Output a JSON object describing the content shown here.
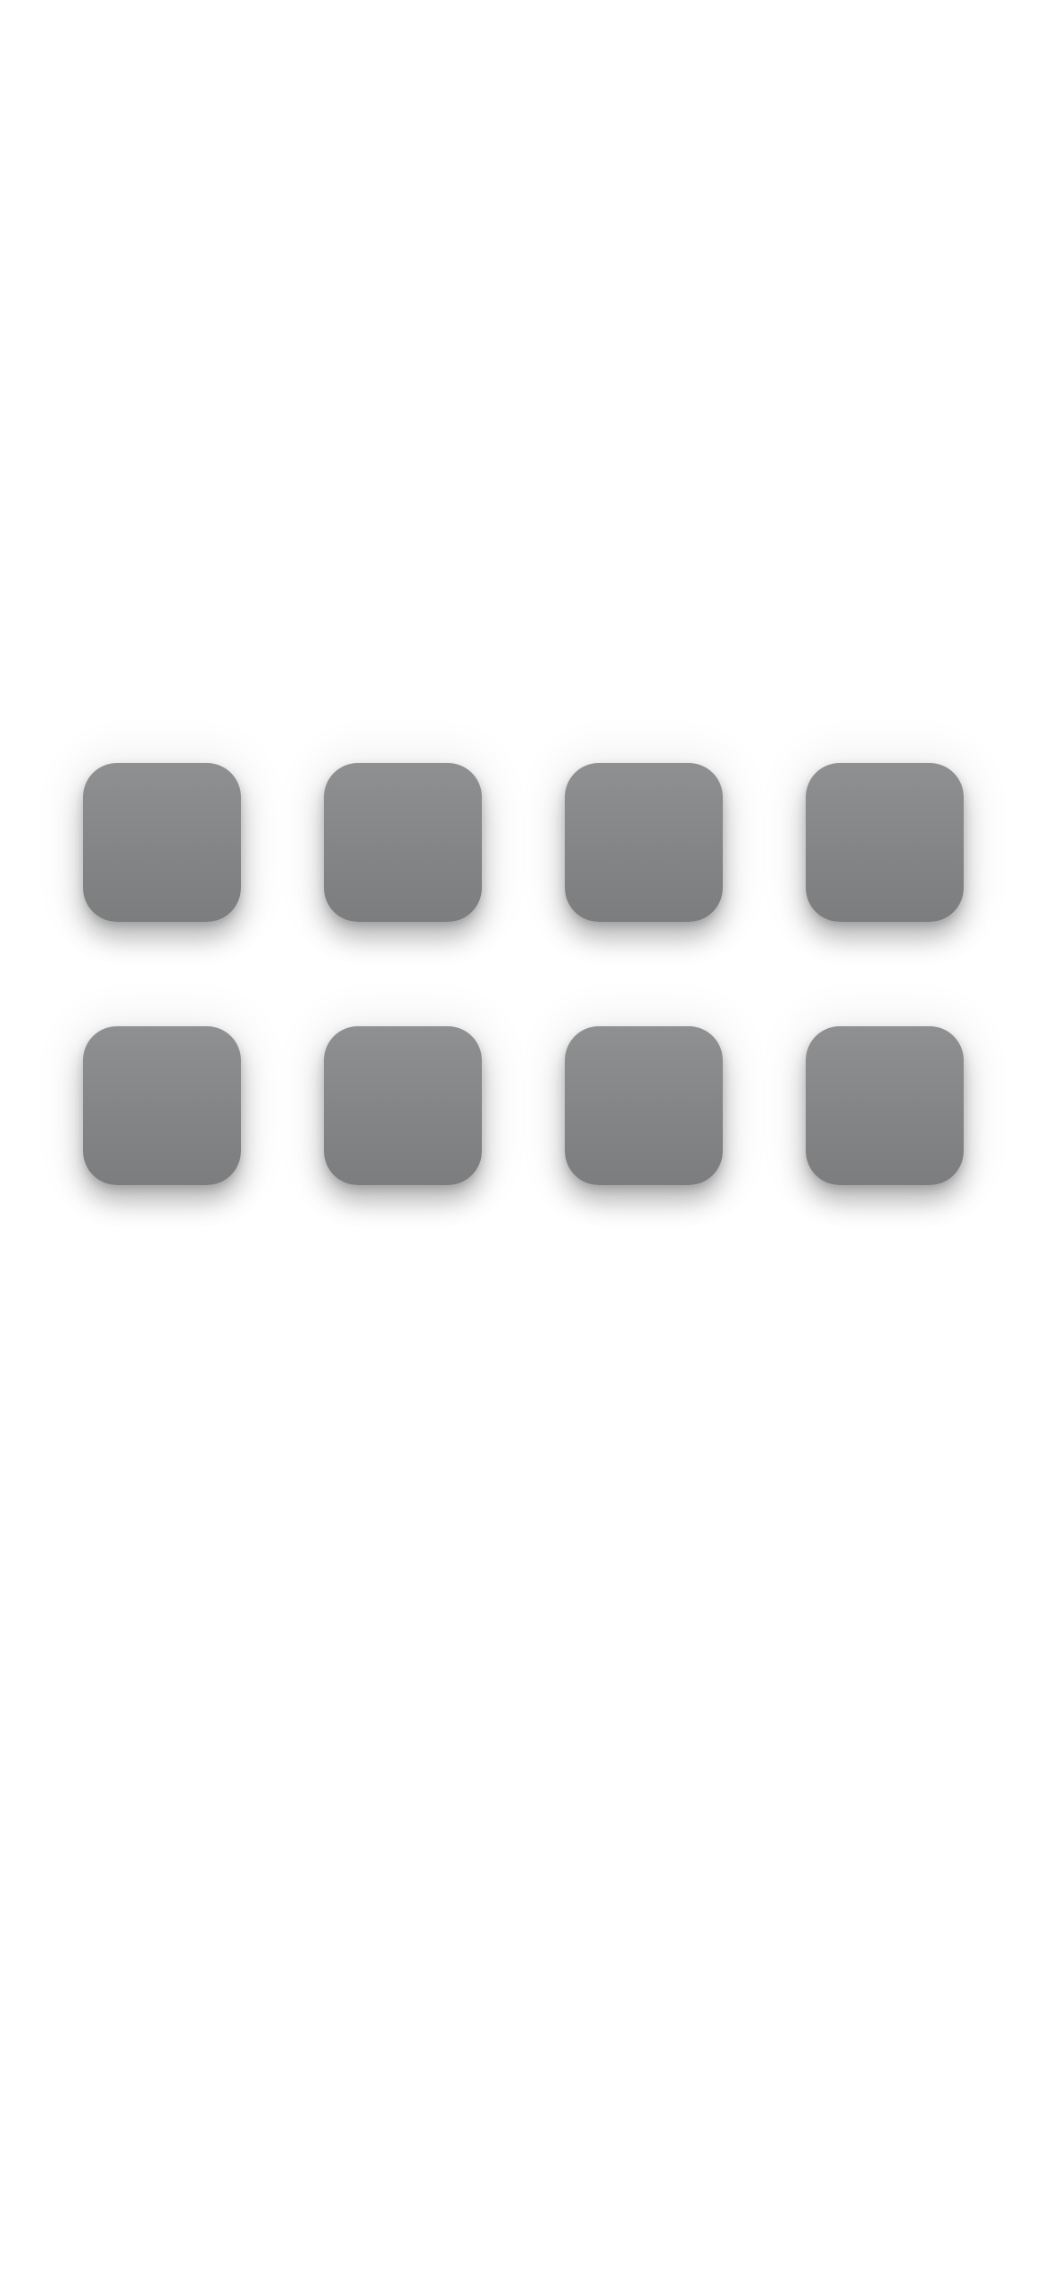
{
  "home_screen": {
    "tile_color": "#858687",
    "background_color": "#ffffff",
    "tiles": [
      {
        "id": 1,
        "label": ""
      },
      {
        "id": 2,
        "label": ""
      },
      {
        "id": 3,
        "label": ""
      },
      {
        "id": 4,
        "label": ""
      },
      {
        "id": 5,
        "label": ""
      },
      {
        "id": 6,
        "label": ""
      },
      {
        "id": 7,
        "label": ""
      },
      {
        "id": 8,
        "label": ""
      }
    ]
  }
}
